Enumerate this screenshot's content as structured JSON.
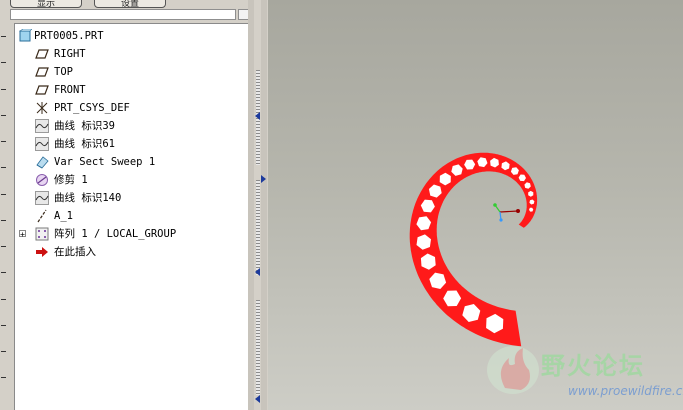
{
  "top_toolbar": {
    "display_btn": "显示",
    "settings_btn": "设置"
  },
  "model_tree": {
    "items": [
      {
        "label": "PRT0005.PRT",
        "icon": "part-icon"
      },
      {
        "label": "RIGHT",
        "icon": "datum-plane-icon"
      },
      {
        "label": "TOP",
        "icon": "datum-plane-icon"
      },
      {
        "label": "FRONT",
        "icon": "datum-plane-icon"
      },
      {
        "label": "PRT_CSYS_DEF",
        "icon": "coordinate-system-icon"
      },
      {
        "label": "曲线 标识39",
        "icon": "datum-curve-icon"
      },
      {
        "label": "曲线 标识61",
        "icon": "datum-curve-icon"
      },
      {
        "label": "Var Sect Sweep 1",
        "icon": "sweep-feature-icon"
      },
      {
        "label": "修剪 1",
        "icon": "trim-feature-icon"
      },
      {
        "label": "曲线 标识140",
        "icon": "datum-curve-icon"
      },
      {
        "label": "A_1",
        "icon": "datum-axis-icon"
      },
      {
        "label": "阵列 1 / LOCAL_GROUP",
        "icon": "pattern-group-icon"
      },
      {
        "label": "在此插入",
        "icon": "insert-here-arrow-icon"
      }
    ]
  },
  "watermark": {
    "title": "野火论坛",
    "url": "www.proewildfire.cn"
  },
  "colors": {
    "spiral": "#ff1a1a",
    "viewport_top": "#a7a79e",
    "viewport_bottom": "#cdcdc6",
    "tree_bg": "#ffffff"
  }
}
